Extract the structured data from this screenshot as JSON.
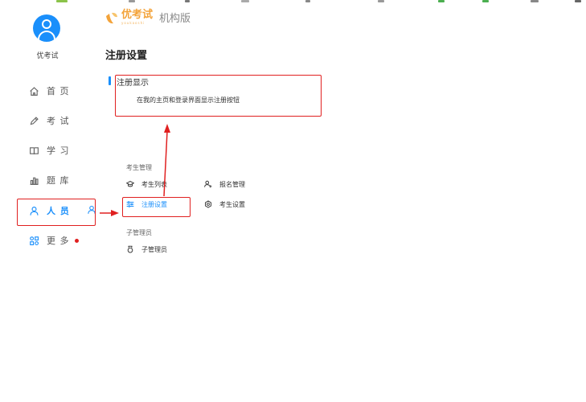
{
  "header": {
    "logo_text": "优考试",
    "logo_sub": "youkaoshi",
    "edition": "机构版"
  },
  "user": {
    "name": "优考试"
  },
  "sidebar": {
    "items": [
      {
        "label": "首 页",
        "icon": "home-icon"
      },
      {
        "label": "考 试",
        "icon": "pencil-icon"
      },
      {
        "label": "学 习",
        "icon": "book-icon"
      },
      {
        "label": "题 库",
        "icon": "bar-chart-icon"
      },
      {
        "label": "人 员",
        "icon": "person-icon",
        "active": true
      },
      {
        "label": "更 多",
        "icon": "apps-icon",
        "badge": "red-dot"
      }
    ]
  },
  "page": {
    "title": "注册设置"
  },
  "register_display": {
    "title": "注册显示",
    "description": "在我的主页和登录界面显示注册按钮"
  },
  "menu": {
    "groups": [
      {
        "title": "考生管理",
        "items": [
          {
            "label": "考生列表",
            "icon": "graduation-cap-icon"
          },
          {
            "label": "报名管理",
            "icon": "person-add-icon"
          },
          {
            "label": "注册设置",
            "icon": "sliders-icon",
            "active": true
          },
          {
            "label": "考生设置",
            "icon": "gear-icon"
          }
        ]
      },
      {
        "title": "子管理员",
        "items": [
          {
            "label": "子管理员",
            "icon": "admin-icon"
          }
        ]
      }
    ]
  },
  "colors": {
    "accent": "#1a8ffb",
    "annotation": "#e02020",
    "logo": "#f3a33a"
  }
}
